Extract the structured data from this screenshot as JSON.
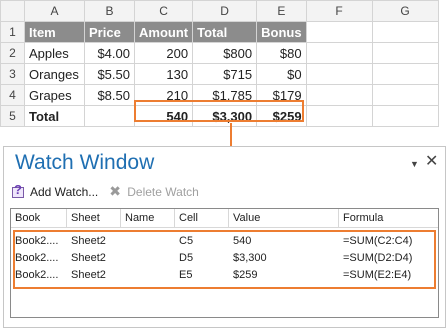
{
  "sheet": {
    "col_headers": [
      "A",
      "B",
      "C",
      "D",
      "E",
      "F",
      "G"
    ],
    "rows": [
      {
        "num": "1",
        "cells": [
          "Item",
          "Price",
          "Amount",
          "Total",
          "Bonus"
        ]
      },
      {
        "num": "2",
        "cells": [
          "Apples",
          "$4.00",
          "200",
          "$800",
          "$80"
        ]
      },
      {
        "num": "3",
        "cells": [
          "Oranges",
          "$5.50",
          "130",
          "$715",
          "$0"
        ]
      },
      {
        "num": "4",
        "cells": [
          "Grapes",
          "$8.50",
          "210",
          "$1,785",
          "$179"
        ]
      },
      {
        "num": "5",
        "cells": [
          "Total",
          "",
          "540",
          "$3,300",
          "$259"
        ]
      }
    ]
  },
  "watch_window": {
    "title": "Watch Window",
    "toolbar": {
      "add_label": "Add Watch...",
      "delete_label": "Delete Watch"
    },
    "columns": [
      "Book",
      "Sheet",
      "Name",
      "Cell",
      "Value",
      "Formula"
    ],
    "rows": [
      {
        "book": "Book2....",
        "sheet": "Sheet2",
        "name": "",
        "cell": "C5",
        "value": "540",
        "formula": "=SUM(C2:C4)"
      },
      {
        "book": "Book2....",
        "sheet": "Sheet2",
        "name": "",
        "cell": "D5",
        "value": "$3,300",
        "formula": "=SUM(D2:D4)"
      },
      {
        "book": "Book2....",
        "sheet": "Sheet2",
        "name": "",
        "cell": "E5",
        "value": "$259",
        "formula": "=SUM(E2:E4)"
      }
    ]
  },
  "icons": {
    "add_watch": "add-watch-icon",
    "delete_watch": "delete-watch-icon",
    "dropdown": "chevron-down-icon",
    "close": "close-icon"
  },
  "colors": {
    "header_fill": "#8c8c8c",
    "highlight": "#ed7d31",
    "title_blue": "#1f6fb2"
  }
}
